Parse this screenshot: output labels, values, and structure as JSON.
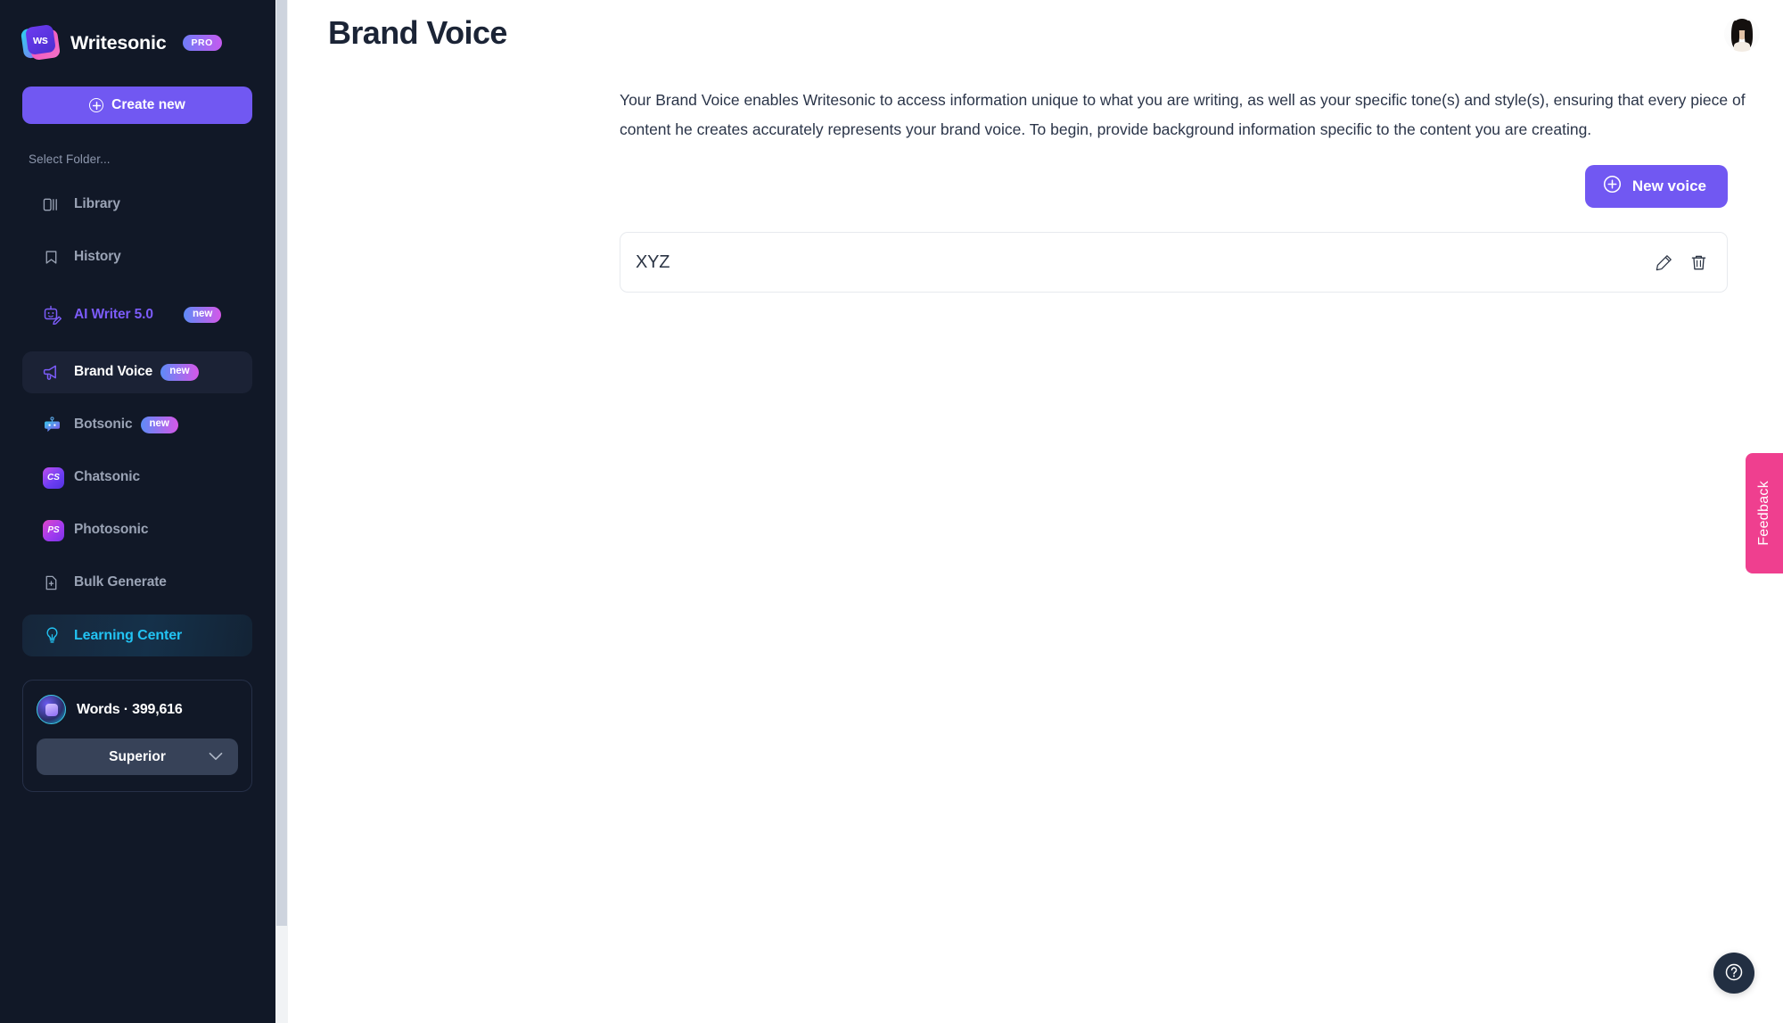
{
  "sidebar": {
    "brand": {
      "name": "Writesonic",
      "badge": "PRO",
      "logo_text": "ws"
    },
    "create_new_label": "Create new",
    "folder_label": "Select Folder...",
    "items": [
      {
        "label": "Library",
        "icon": "library-icon",
        "badge": null,
        "state": "default"
      },
      {
        "label": "History",
        "icon": "bookmark-icon",
        "badge": null,
        "state": "default"
      },
      {
        "label": "AI Writer 5.0",
        "icon": "ai-writer-icon",
        "badge": "new",
        "state": "purple"
      },
      {
        "label": "Brand Voice",
        "icon": "megaphone-icon",
        "badge": "new",
        "state": "active"
      },
      {
        "label": "Botsonic",
        "icon": "bot-icon",
        "badge": "new",
        "state": "default"
      },
      {
        "label": "Chatsonic",
        "icon": "chatsonic-icon",
        "badge": null,
        "state": "default"
      },
      {
        "label": "Photosonic",
        "icon": "photosonic-icon",
        "badge": null,
        "state": "default"
      },
      {
        "label": "Bulk Generate",
        "icon": "file-plus-icon",
        "badge": null,
        "state": "default"
      },
      {
        "label": "Learning Center",
        "icon": "lightbulb-icon",
        "badge": null,
        "state": "learning"
      }
    ],
    "usage": {
      "words_label": "Words",
      "separator": "·",
      "words_count": "399,616",
      "plan": "Superior"
    }
  },
  "header": {
    "title": "Brand Voice",
    "avatar_name": "user-avatar"
  },
  "main": {
    "description_line1": "Your Brand Voice enables Writesonic to access information unique to what you are writing, as well as your specific tone(s) and style(s), ensuring that every piece of",
    "description_line2": "content he creates accurately represents your brand voice. To begin, provide background information specific to the content you are creating.",
    "new_voice_label": "New voice",
    "voices": [
      {
        "name": "XYZ",
        "edit_label": "edit",
        "delete_label": "delete"
      }
    ]
  },
  "feedback": {
    "label": "Feedback"
  },
  "help": {
    "label": "?"
  },
  "colors": {
    "sidebar_bg": "#111827",
    "accent_purple": "#7158f2",
    "learning_cyan": "#22c3f3",
    "feedback_pink": "#ef3f8f",
    "text_dark": "#1b2436",
    "muted": "#9aa3b5"
  }
}
